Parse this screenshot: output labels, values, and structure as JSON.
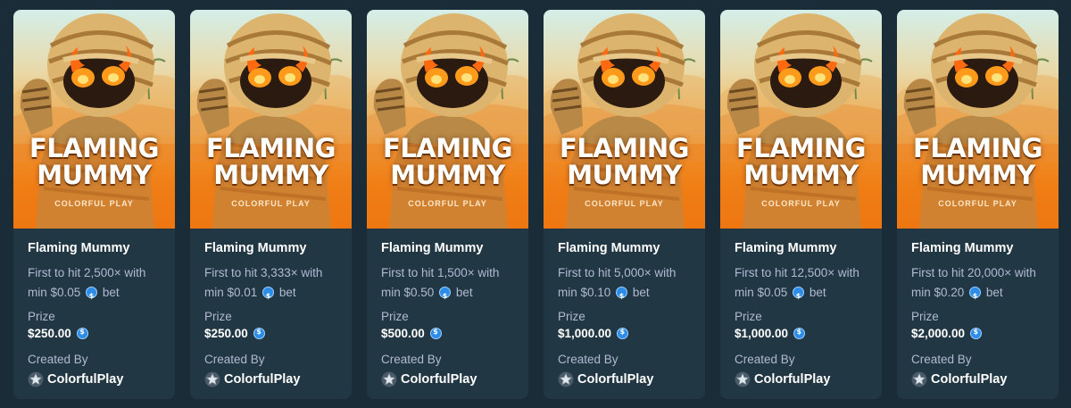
{
  "labels": {
    "prize": "Prize",
    "created_by": "Created By",
    "bet_suffix": "bet"
  },
  "thumbnail": {
    "title_line1": "FLAMING",
    "title_line2": "MUMMY",
    "studio": "COLORFUL PLAY"
  },
  "cards": [
    {
      "title": "Flaming Mummy",
      "desc_line1": "First to hit 2,500× with",
      "min_bet": "min $0.05",
      "prize": "$250.00",
      "creator": "ColorfulPlay"
    },
    {
      "title": "Flaming Mummy",
      "desc_line1": "First to hit 3,333× with",
      "min_bet": "min $0.01",
      "prize": "$250.00",
      "creator": "ColorfulPlay"
    },
    {
      "title": "Flaming Mummy",
      "desc_line1": "First to hit 1,500× with",
      "min_bet": "min $0.50",
      "prize": "$500.00",
      "creator": "ColorfulPlay"
    },
    {
      "title": "Flaming Mummy",
      "desc_line1": "First to hit 5,000× with",
      "min_bet": "min $0.10",
      "prize": "$1,000.00",
      "creator": "ColorfulPlay"
    },
    {
      "title": "Flaming Mummy",
      "desc_line1": "First to hit 12,500× with",
      "min_bet": "min $0.05",
      "prize": "$1,000.00",
      "creator": "ColorfulPlay"
    },
    {
      "title": "Flaming Mummy",
      "desc_line1": "First to hit 20,000× with",
      "min_bet": "min $0.20",
      "prize": "$2,000.00",
      "creator": "ColorfulPlay"
    }
  ],
  "colors": {
    "background": "#1a2c38",
    "card": "#213743",
    "muted_text": "#b1bad3",
    "coin": "#2d8ce8"
  },
  "icons": {
    "currency": "usd-coin-icon",
    "creator_badge": "star-badge-icon"
  }
}
